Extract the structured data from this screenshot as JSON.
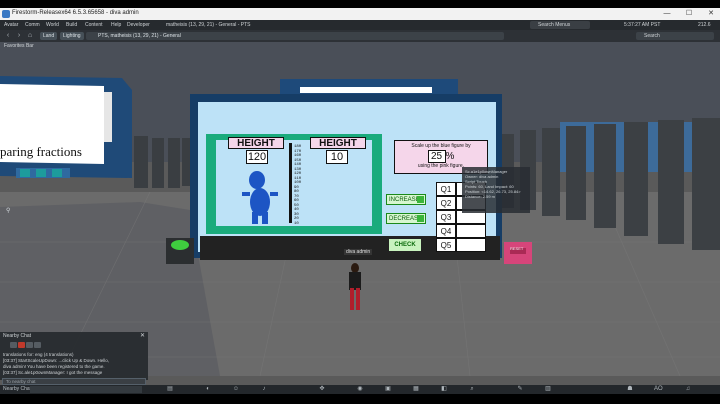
{
  "window": {
    "title": "Firestorm-Releasex64 6.5.3.65658 - diva admin",
    "minimize": "—",
    "maximize": "☐",
    "close": "✕"
  },
  "menu": {
    "items": [
      "Avatar",
      "Comm",
      "World",
      "Build",
      "Content",
      "Help",
      "Developer"
    ],
    "location_status": "matheisis (13, 29, 21) - General - PTS",
    "search_menus": "Search Menus",
    "clock": "5:37:27 AM PST",
    "fps": "212.6"
  },
  "navbar": {
    "back": "‹",
    "forward": "›",
    "home": "⌂",
    "land_button": "Land",
    "lighting_button": "Lighting",
    "location": "PTS, matheisis (13, 29, 21) - General",
    "search": "Search"
  },
  "favorites": "Favorites Bar",
  "scene": {
    "left_board_text": "paring fractions",
    "height_label_left": "HEIGHT",
    "height_value_left": "120",
    "height_label_right": "HEIGHT",
    "height_value_right": "10",
    "scale_line1": "Scale up the blue figure by",
    "scale_value": "25",
    "scale_pct": "%",
    "scale_line2": "using the pink figure.",
    "increase": "INCREASE",
    "decrease": "DECREASE",
    "check": "CHECK",
    "questions": [
      "Q1",
      "Q2",
      "Q3",
      "Q4",
      "Q5"
    ],
    "ruler_labels": [
      "180",
      "170",
      "160",
      "150",
      "140",
      "130",
      "120",
      "110",
      "100",
      "90",
      "80",
      "70",
      "60",
      "50",
      "40",
      "30",
      "20",
      "10"
    ],
    "tooltip_lines": [
      "Sc.a1e1p0ownManager",
      "Owner: diva admin",
      "Script Touch",
      "Points: 60, Land Impact: 60",
      "Position: <14.62, 26.73, 25.84>",
      "Distance: 2.59 m"
    ],
    "avatar_tag": "diva admin",
    "reset_label": "RESET"
  },
  "chat": {
    "title": "Nearby Chat",
    "close": "✕",
    "lines": [
      "translations for: eng (4 translations)",
      "[03:37] StartScaleUpDown: ...click Up & Down. Hello,",
      "diva admin! You have been registered to the game.",
      "[03:37] Sc.ale1p0ownManager: I got the message"
    ],
    "input_placeholder": "To nearby chat"
  },
  "bottombar": {
    "nearby_label": "Nearby Chat",
    "icons": [
      "chat-icon",
      "people-icon",
      "gesture-icon",
      "voice-icon",
      "move-icon",
      "view-icon",
      "snapshot-icon",
      "map-icon",
      "minimap-icon",
      "search-icon",
      "build-icon",
      "inventory-icon",
      "appearance-icon",
      "ao-icon",
      "sound-icon"
    ],
    "glyphs": [
      "▤",
      "◐",
      "☺",
      "♪",
      "✥",
      "◉",
      "▣",
      "▦",
      "◧",
      "⌕",
      "✎",
      "▥",
      "☗",
      "AO",
      "♫"
    ]
  }
}
